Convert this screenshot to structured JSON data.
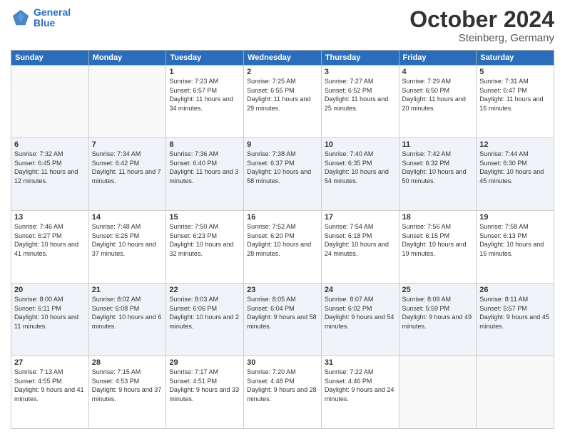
{
  "header": {
    "logo_line1": "General",
    "logo_line2": "Blue",
    "month": "October 2024",
    "location": "Steinberg, Germany"
  },
  "days_of_week": [
    "Sunday",
    "Monday",
    "Tuesday",
    "Wednesday",
    "Thursday",
    "Friday",
    "Saturday"
  ],
  "weeks": [
    {
      "days": [
        {
          "num": "",
          "info": "",
          "empty": true
        },
        {
          "num": "",
          "info": "",
          "empty": true
        },
        {
          "num": "1",
          "info": "Sunrise: 7:23 AM\nSunset: 6:57 PM\nDaylight: 11 hours and 34 minutes."
        },
        {
          "num": "2",
          "info": "Sunrise: 7:25 AM\nSunset: 6:55 PM\nDaylight: 11 hours and 29 minutes."
        },
        {
          "num": "3",
          "info": "Sunrise: 7:27 AM\nSunset: 6:52 PM\nDaylight: 11 hours and 25 minutes."
        },
        {
          "num": "4",
          "info": "Sunrise: 7:29 AM\nSunset: 6:50 PM\nDaylight: 11 hours and 20 minutes."
        },
        {
          "num": "5",
          "info": "Sunrise: 7:31 AM\nSunset: 6:47 PM\nDaylight: 11 hours and 16 minutes."
        }
      ]
    },
    {
      "days": [
        {
          "num": "6",
          "info": "Sunrise: 7:32 AM\nSunset: 6:45 PM\nDaylight: 11 hours and 12 minutes."
        },
        {
          "num": "7",
          "info": "Sunrise: 7:34 AM\nSunset: 6:42 PM\nDaylight: 11 hours and 7 minutes."
        },
        {
          "num": "8",
          "info": "Sunrise: 7:36 AM\nSunset: 6:40 PM\nDaylight: 11 hours and 3 minutes."
        },
        {
          "num": "9",
          "info": "Sunrise: 7:38 AM\nSunset: 6:37 PM\nDaylight: 10 hours and 58 minutes."
        },
        {
          "num": "10",
          "info": "Sunrise: 7:40 AM\nSunset: 6:35 PM\nDaylight: 10 hours and 54 minutes."
        },
        {
          "num": "11",
          "info": "Sunrise: 7:42 AM\nSunset: 6:32 PM\nDaylight: 10 hours and 50 minutes."
        },
        {
          "num": "12",
          "info": "Sunrise: 7:44 AM\nSunset: 6:30 PM\nDaylight: 10 hours and 45 minutes."
        }
      ]
    },
    {
      "days": [
        {
          "num": "13",
          "info": "Sunrise: 7:46 AM\nSunset: 6:27 PM\nDaylight: 10 hours and 41 minutes."
        },
        {
          "num": "14",
          "info": "Sunrise: 7:48 AM\nSunset: 6:25 PM\nDaylight: 10 hours and 37 minutes."
        },
        {
          "num": "15",
          "info": "Sunrise: 7:50 AM\nSunset: 6:23 PM\nDaylight: 10 hours and 32 minutes."
        },
        {
          "num": "16",
          "info": "Sunrise: 7:52 AM\nSunset: 6:20 PM\nDaylight: 10 hours and 28 minutes."
        },
        {
          "num": "17",
          "info": "Sunrise: 7:54 AM\nSunset: 6:18 PM\nDaylight: 10 hours and 24 minutes."
        },
        {
          "num": "18",
          "info": "Sunrise: 7:56 AM\nSunset: 6:15 PM\nDaylight: 10 hours and 19 minutes."
        },
        {
          "num": "19",
          "info": "Sunrise: 7:58 AM\nSunset: 6:13 PM\nDaylight: 10 hours and 15 minutes."
        }
      ]
    },
    {
      "days": [
        {
          "num": "20",
          "info": "Sunrise: 8:00 AM\nSunset: 6:11 PM\nDaylight: 10 hours and 11 minutes."
        },
        {
          "num": "21",
          "info": "Sunrise: 8:02 AM\nSunset: 6:08 PM\nDaylight: 10 hours and 6 minutes."
        },
        {
          "num": "22",
          "info": "Sunrise: 8:03 AM\nSunset: 6:06 PM\nDaylight: 10 hours and 2 minutes."
        },
        {
          "num": "23",
          "info": "Sunrise: 8:05 AM\nSunset: 6:04 PM\nDaylight: 9 hours and 58 minutes."
        },
        {
          "num": "24",
          "info": "Sunrise: 8:07 AM\nSunset: 6:02 PM\nDaylight: 9 hours and 54 minutes."
        },
        {
          "num": "25",
          "info": "Sunrise: 8:09 AM\nSunset: 5:59 PM\nDaylight: 9 hours and 49 minutes."
        },
        {
          "num": "26",
          "info": "Sunrise: 8:11 AM\nSunset: 5:57 PM\nDaylight: 9 hours and 45 minutes."
        }
      ]
    },
    {
      "days": [
        {
          "num": "27",
          "info": "Sunrise: 7:13 AM\nSunset: 4:55 PM\nDaylight: 9 hours and 41 minutes."
        },
        {
          "num": "28",
          "info": "Sunrise: 7:15 AM\nSunset: 4:53 PM\nDaylight: 9 hours and 37 minutes."
        },
        {
          "num": "29",
          "info": "Sunrise: 7:17 AM\nSunset: 4:51 PM\nDaylight: 9 hours and 33 minutes."
        },
        {
          "num": "30",
          "info": "Sunrise: 7:20 AM\nSunset: 4:48 PM\nDaylight: 9 hours and 28 minutes."
        },
        {
          "num": "31",
          "info": "Sunrise: 7:22 AM\nSunset: 4:46 PM\nDaylight: 9 hours and 24 minutes."
        },
        {
          "num": "",
          "info": "",
          "empty": true
        },
        {
          "num": "",
          "info": "",
          "empty": true
        }
      ]
    }
  ]
}
